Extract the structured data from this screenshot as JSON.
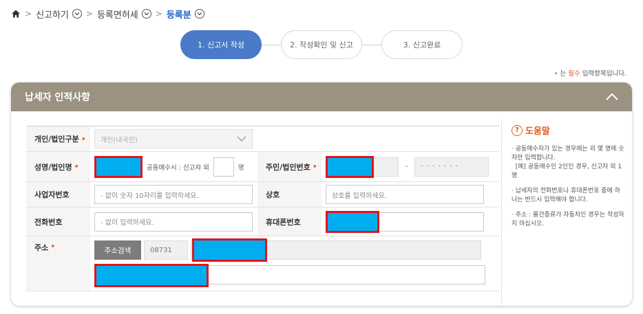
{
  "breadcrumb": {
    "items": [
      {
        "label": "신고하기"
      },
      {
        "label": "등록면허세"
      },
      {
        "label": "등록분"
      }
    ]
  },
  "steps": [
    {
      "label": "1. 신고서 작성",
      "active": true
    },
    {
      "label": "2. 작성확인 및 신고",
      "active": false
    },
    {
      "label": "3. 신고완료",
      "active": false
    }
  ],
  "required_note": {
    "marker": "•",
    "prefix": " 는 ",
    "highlight": "필수",
    "suffix": " 입력항목입니다."
  },
  "panel": {
    "title": "납세자 인적사항"
  },
  "form": {
    "required_marker": "•",
    "type_label": "개인/법인구분",
    "type_value": "개인(내국인)",
    "name_label": "성명/법인명",
    "co_buyer_prefix": "공동매수시 : 신고자 외",
    "co_buyer_value": "",
    "co_buyer_unit": "명",
    "id_label": "주민/법인번호",
    "id_separator": "-",
    "id_back": "· · · · · · ·",
    "biz_label": "사업자번호",
    "biz_placeholder": "- 없이 숫자 10자리를 입력하세요.",
    "trade_label": "상호",
    "trade_placeholder": "상호를 입력하세요.",
    "phone_label": "전화번호",
    "phone_placeholder": "- 없이 입력하세요.",
    "mobile_label": "휴대폰번호",
    "address_label": "주소",
    "address_search_button": "주소검색",
    "zip_code": "08731"
  },
  "help": {
    "title": "도움말",
    "items": [
      "· 공동매수자가 있는 경우에는 외 몇 명에 숫자만 입력합니다.\n  [예] 공동매수인 2인인 경우, 신고자 외 1명",
      "· 납세자의 전화번호나 휴대폰번호 중에 하나는 반드시 입력해야 합니다.",
      "· 주소 : 물건종류가 자동차인 경우는 작성하지 마십시오."
    ]
  },
  "colors": {
    "accent_blue": "#4a7ac8",
    "panel_header": "#9c9282",
    "required_orange": "#e86a1a",
    "redaction_fill": "#00adef",
    "redaction_border": "#e0141a"
  }
}
